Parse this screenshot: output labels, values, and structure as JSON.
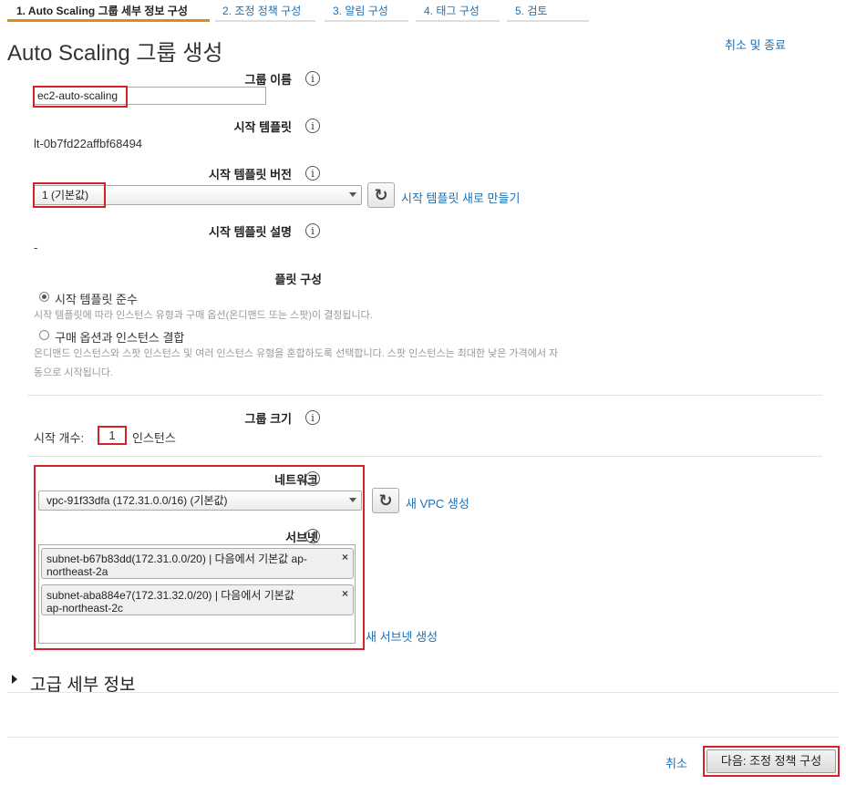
{
  "wizard": {
    "steps": [
      {
        "label": "1. Auto Scaling 그룹 세부 정보 구성",
        "active": true
      },
      {
        "label": "2. 조정 정책 구성",
        "active": false
      },
      {
        "label": "3. 알림 구성",
        "active": false
      },
      {
        "label": "4. 태그 구성",
        "active": false
      },
      {
        "label": "5. 검토",
        "active": false
      }
    ]
  },
  "header": {
    "title": "Auto Scaling 그룹 생성",
    "cancel_and_close": "취소 및 종료"
  },
  "form": {
    "group_name": {
      "label": "그룹 이름",
      "value": "ec2-auto-scaling"
    },
    "launch_template": {
      "label": "시작 템플릿",
      "value": "lt-0b7fd22affbf68494"
    },
    "launch_template_version": {
      "label": "시작 템플릿 버전",
      "selected": "1 (기본값)",
      "create_new_link": "시작 템플릿 새로 만들기"
    },
    "launch_template_description": {
      "label": "시작 템플릿 설명",
      "value": "-"
    },
    "fleet": {
      "label": "플릿 구성",
      "options": [
        {
          "label": "시작 템플릿 준수",
          "checked": true,
          "help": "시작 템플릿에 따라 인스턴스 유형과 구매 옵션(온디맨드 또는 스팟)이 결정됩니다."
        },
        {
          "label": "구매 옵션과 인스턴스 결합",
          "checked": false,
          "help_line1": "온디맨드 인스턴스와 스팟 인스턴스 및 여러 인스턴스 유형을 혼합하도록 선택합니다. 스팟 인스턴스는 최대한 낮은 가격에서 자",
          "help_line2": "동으로 시작됩니다."
        }
      ]
    },
    "group_size": {
      "label": "그룹 크기",
      "prefix": "시작 개수:",
      "value": "1",
      "suffix": "인스턴스"
    },
    "network": {
      "label": "네트워크",
      "selected": "vpc-91f33dfa (172.31.0.0/16) (기본값)",
      "create_link": "새 VPC 생성"
    },
    "subnet": {
      "label": "서브넷",
      "chips": [
        {
          "line1": "subnet-b67b83dd(172.31.0.0/20) | 다음에서 기본값 ap-",
          "line2": "northeast-2a"
        },
        {
          "line1": "subnet-aba884e7(172.31.32.0/20) | 다음에서 기본값",
          "line2": "ap-northeast-2c"
        }
      ],
      "remove_glyph": "×",
      "create_link": "새 서브넷 생성"
    },
    "advanced": {
      "label": "고급 세부 정보"
    }
  },
  "footer": {
    "cancel": "취소",
    "next": "다음: 조정 정책 구성"
  },
  "icons": {
    "info": "info-icon",
    "refresh": "refresh-icon",
    "caret": "caret-right-icon"
  },
  "colors": {
    "accent_tab": "#e48a1a",
    "link": "#1d6fb5",
    "highlight": "#d6212a"
  }
}
